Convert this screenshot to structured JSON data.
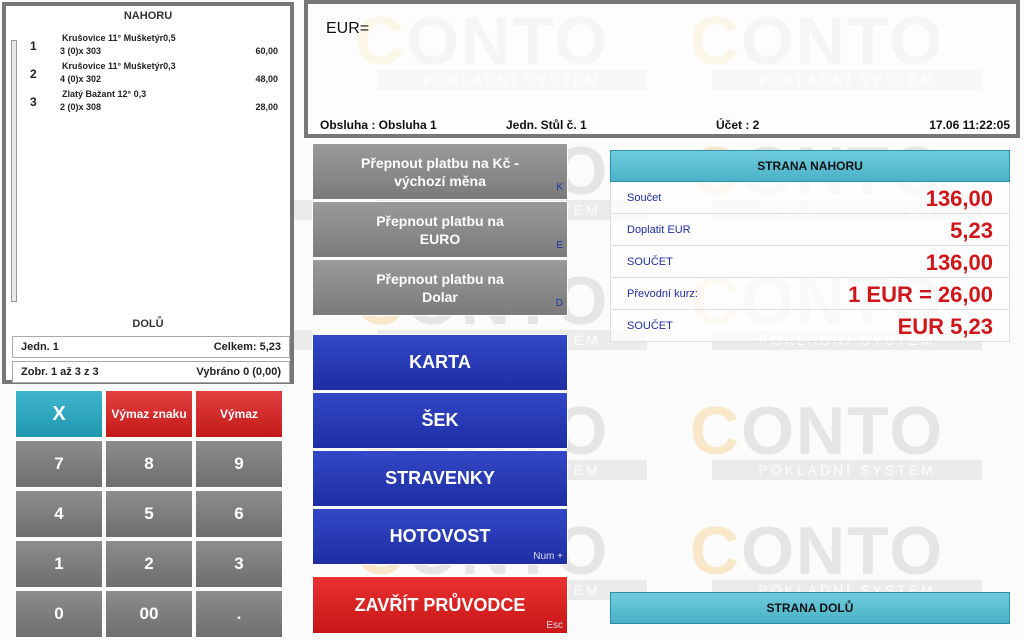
{
  "receipt": {
    "up_label": "NAHORU",
    "down_label": "DOLŮ",
    "items": [
      {
        "num": "1",
        "name": "Krušovice 11° Mušketýr0,5",
        "qty": "3 (0)x 303",
        "price": "60,00"
      },
      {
        "num": "2",
        "name": "Krušovice 11° Mušketýr0,3",
        "qty": "4 (0)x 302",
        "price": "48,00"
      },
      {
        "num": "3",
        "name": "Zlatý Bažant 12° 0,3",
        "qty": "2 (0)x 308",
        "price": "28,00"
      }
    ],
    "unit_label": "Jedn.  1",
    "total_label": "Celkem: 5,23",
    "shown_label": "Zobr.  1 až 3 z 3",
    "selected_label": "Vybráno 0 (0,00)"
  },
  "display": {
    "entry": "EUR=",
    "operator": "Obsluha : Obsluha 1",
    "table": "Jedn. Stůl č. 1",
    "account": "Účet : 2",
    "datetime": "17.06 11:22:05"
  },
  "keypad": {
    "clear": "X",
    "delete_char": "Výmaz znaku",
    "delete": "Výmaz",
    "k7": "7",
    "k8": "8",
    "k9": "9",
    "k4": "4",
    "k5": "5",
    "k6": "6",
    "k1": "1",
    "k2": "2",
    "k3": "3",
    "k0": "0",
    "k00": "00",
    "kdot": "."
  },
  "payment": {
    "czk": {
      "label": "Přepnout platbu na Kč - výchozí měna",
      "hotkey": "K"
    },
    "euro": {
      "label": "Přepnout platbu na EURO",
      "hotkey": "E"
    },
    "dolar": {
      "label": "Přepnout platbu na Dolar",
      "hotkey": "D"
    },
    "card": {
      "label": "KARTA"
    },
    "check": {
      "label": "ŠEK"
    },
    "meal": {
      "label": "STRAVENKY"
    },
    "cash": {
      "label": "HOTOVOST",
      "hotkey": "Num +"
    },
    "close": {
      "label": "ZAVŘÍT PRŮVODCE",
      "hotkey": "Esc"
    }
  },
  "summary": {
    "up_label": "STRANA NAHORU",
    "down_label": "STRANA DOLŮ",
    "rows": [
      {
        "label": "Součet",
        "value": "136,00"
      },
      {
        "label": "Doplatit EUR",
        "value": "5,23"
      },
      {
        "label": "SOUČET",
        "value": "136,00"
      },
      {
        "label": "Převodní kurz:",
        "value": "1 EUR = 26,00"
      },
      {
        "label": "SOUČET",
        "value": "EUR 5,23"
      }
    ]
  },
  "watermark": {
    "brand": "CONTO",
    "tagline": "POKLADNÍ SYSTÉM"
  },
  "colors": {
    "blue_button": "#2437b5",
    "red_button": "#d42222",
    "teal": "#36a9c0",
    "value_red": "#d0161a"
  }
}
